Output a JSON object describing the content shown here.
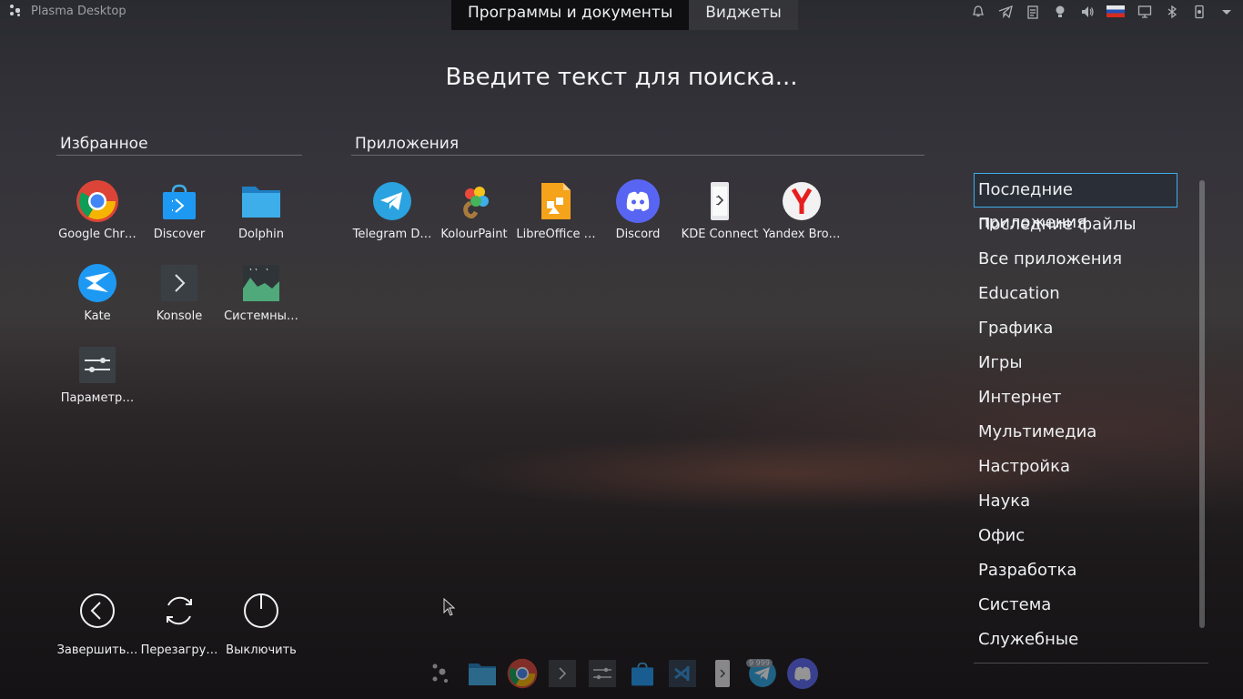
{
  "panel": {
    "title": "Plasma Desktop"
  },
  "tabs": [
    {
      "label": "Программы и документы"
    },
    {
      "label": "Виджеты"
    }
  ],
  "search": {
    "placeholder": "Введите текст для поиска..."
  },
  "favorites": {
    "title": "Избранное",
    "items": [
      {
        "label": "Google Chr…",
        "icon": "chrome-icon"
      },
      {
        "label": "Discover",
        "icon": "discover-icon"
      },
      {
        "label": "Dolphin",
        "icon": "folder-icon"
      },
      {
        "label": "Kate",
        "icon": "kate-icon"
      },
      {
        "label": "Konsole",
        "icon": "terminal-icon"
      },
      {
        "label": "Системны…",
        "icon": "system-monitor-icon"
      },
      {
        "label": "Параметр…",
        "icon": "settings-icon"
      }
    ]
  },
  "applications": {
    "title": "Приложения",
    "items": [
      {
        "label": "Telegram D…",
        "icon": "telegram-icon"
      },
      {
        "label": "KolourPaint",
        "icon": "kolourpaint-icon"
      },
      {
        "label": "LibreOffice …",
        "icon": "libreoffice-impress-icon"
      },
      {
        "label": "Discord",
        "icon": "discord-icon"
      },
      {
        "label": "KDE Connect",
        "icon": "kdeconnect-icon"
      },
      {
        "label": "Yandex Bro…",
        "icon": "yandex-browser-icon"
      }
    ]
  },
  "categories": [
    "Последние приложения",
    "Последние файлы",
    "Все приложения",
    "Education",
    "Графика",
    "Игры",
    "Интернет",
    "Мультимедиа",
    "Настройка",
    "Наука",
    "Офис",
    "Разработка",
    "Система",
    "Служебные"
  ],
  "power": [
    {
      "label": "Завершить…",
      "icon": "logout-icon"
    },
    {
      "label": "Перезагру…",
      "icon": "restart-icon"
    },
    {
      "label": "Выключить",
      "icon": "shutdown-icon"
    }
  ],
  "taskbar": {
    "badge": "9 999"
  },
  "colors": {
    "accent": "#3daee9",
    "discord": "#5865f2",
    "telegram": "#2aa3e0",
    "yandex": "#e61e1e"
  }
}
